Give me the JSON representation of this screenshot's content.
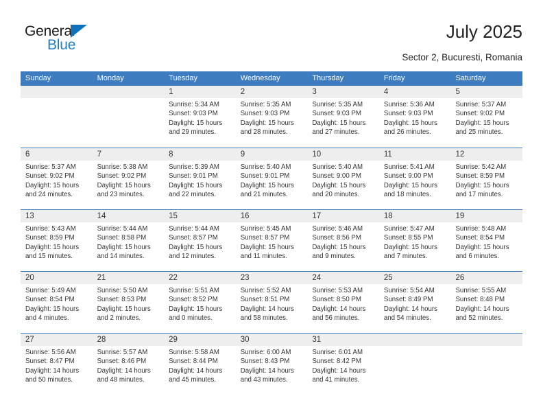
{
  "logo": {
    "word1": "General",
    "word2": "Blue",
    "triangle_color": "#1172ba",
    "word2_color": "#1f7ec4"
  },
  "header": {
    "title": "July 2025",
    "subtitle": "Sector 2, Bucuresti, Romania"
  },
  "theme": {
    "header_bg": "#3d7dbf",
    "header_text": "#ffffff",
    "daynum_band_bg": "#eeeeee",
    "row_divider": "#3d7dbf",
    "body_text": "#333333"
  },
  "weekdays": [
    "Sunday",
    "Monday",
    "Tuesday",
    "Wednesday",
    "Thursday",
    "Friday",
    "Saturday"
  ],
  "labels": {
    "sunrise": "Sunrise:",
    "sunset": "Sunset:",
    "daylight": "Daylight:"
  },
  "weeks": [
    [
      {
        "day": "",
        "blank": true
      },
      {
        "day": "",
        "blank": true
      },
      {
        "day": "1",
        "sunrise": "Sunrise: 5:34 AM",
        "sunset": "Sunset: 9:03 PM",
        "daylight1": "Daylight: 15 hours",
        "daylight2": "and 29 minutes."
      },
      {
        "day": "2",
        "sunrise": "Sunrise: 5:35 AM",
        "sunset": "Sunset: 9:03 PM",
        "daylight1": "Daylight: 15 hours",
        "daylight2": "and 28 minutes."
      },
      {
        "day": "3",
        "sunrise": "Sunrise: 5:35 AM",
        "sunset": "Sunset: 9:03 PM",
        "daylight1": "Daylight: 15 hours",
        "daylight2": "and 27 minutes."
      },
      {
        "day": "4",
        "sunrise": "Sunrise: 5:36 AM",
        "sunset": "Sunset: 9:03 PM",
        "daylight1": "Daylight: 15 hours",
        "daylight2": "and 26 minutes."
      },
      {
        "day": "5",
        "sunrise": "Sunrise: 5:37 AM",
        "sunset": "Sunset: 9:02 PM",
        "daylight1": "Daylight: 15 hours",
        "daylight2": "and 25 minutes."
      }
    ],
    [
      {
        "day": "6",
        "sunrise": "Sunrise: 5:37 AM",
        "sunset": "Sunset: 9:02 PM",
        "daylight1": "Daylight: 15 hours",
        "daylight2": "and 24 minutes."
      },
      {
        "day": "7",
        "sunrise": "Sunrise: 5:38 AM",
        "sunset": "Sunset: 9:02 PM",
        "daylight1": "Daylight: 15 hours",
        "daylight2": "and 23 minutes."
      },
      {
        "day": "8",
        "sunrise": "Sunrise: 5:39 AM",
        "sunset": "Sunset: 9:01 PM",
        "daylight1": "Daylight: 15 hours",
        "daylight2": "and 22 minutes."
      },
      {
        "day": "9",
        "sunrise": "Sunrise: 5:40 AM",
        "sunset": "Sunset: 9:01 PM",
        "daylight1": "Daylight: 15 hours",
        "daylight2": "and 21 minutes."
      },
      {
        "day": "10",
        "sunrise": "Sunrise: 5:40 AM",
        "sunset": "Sunset: 9:00 PM",
        "daylight1": "Daylight: 15 hours",
        "daylight2": "and 20 minutes."
      },
      {
        "day": "11",
        "sunrise": "Sunrise: 5:41 AM",
        "sunset": "Sunset: 9:00 PM",
        "daylight1": "Daylight: 15 hours",
        "daylight2": "and 18 minutes."
      },
      {
        "day": "12",
        "sunrise": "Sunrise: 5:42 AM",
        "sunset": "Sunset: 8:59 PM",
        "daylight1": "Daylight: 15 hours",
        "daylight2": "and 17 minutes."
      }
    ],
    [
      {
        "day": "13",
        "sunrise": "Sunrise: 5:43 AM",
        "sunset": "Sunset: 8:59 PM",
        "daylight1": "Daylight: 15 hours",
        "daylight2": "and 15 minutes."
      },
      {
        "day": "14",
        "sunrise": "Sunrise: 5:44 AM",
        "sunset": "Sunset: 8:58 PM",
        "daylight1": "Daylight: 15 hours",
        "daylight2": "and 14 minutes."
      },
      {
        "day": "15",
        "sunrise": "Sunrise: 5:44 AM",
        "sunset": "Sunset: 8:57 PM",
        "daylight1": "Daylight: 15 hours",
        "daylight2": "and 12 minutes."
      },
      {
        "day": "16",
        "sunrise": "Sunrise: 5:45 AM",
        "sunset": "Sunset: 8:57 PM",
        "daylight1": "Daylight: 15 hours",
        "daylight2": "and 11 minutes."
      },
      {
        "day": "17",
        "sunrise": "Sunrise: 5:46 AM",
        "sunset": "Sunset: 8:56 PM",
        "daylight1": "Daylight: 15 hours",
        "daylight2": "and 9 minutes."
      },
      {
        "day": "18",
        "sunrise": "Sunrise: 5:47 AM",
        "sunset": "Sunset: 8:55 PM",
        "daylight1": "Daylight: 15 hours",
        "daylight2": "and 7 minutes."
      },
      {
        "day": "19",
        "sunrise": "Sunrise: 5:48 AM",
        "sunset": "Sunset: 8:54 PM",
        "daylight1": "Daylight: 15 hours",
        "daylight2": "and 6 minutes."
      }
    ],
    [
      {
        "day": "20",
        "sunrise": "Sunrise: 5:49 AM",
        "sunset": "Sunset: 8:54 PM",
        "daylight1": "Daylight: 15 hours",
        "daylight2": "and 4 minutes."
      },
      {
        "day": "21",
        "sunrise": "Sunrise: 5:50 AM",
        "sunset": "Sunset: 8:53 PM",
        "daylight1": "Daylight: 15 hours",
        "daylight2": "and 2 minutes."
      },
      {
        "day": "22",
        "sunrise": "Sunrise: 5:51 AM",
        "sunset": "Sunset: 8:52 PM",
        "daylight1": "Daylight: 15 hours",
        "daylight2": "and 0 minutes."
      },
      {
        "day": "23",
        "sunrise": "Sunrise: 5:52 AM",
        "sunset": "Sunset: 8:51 PM",
        "daylight1": "Daylight: 14 hours",
        "daylight2": "and 58 minutes."
      },
      {
        "day": "24",
        "sunrise": "Sunrise: 5:53 AM",
        "sunset": "Sunset: 8:50 PM",
        "daylight1": "Daylight: 14 hours",
        "daylight2": "and 56 minutes."
      },
      {
        "day": "25",
        "sunrise": "Sunrise: 5:54 AM",
        "sunset": "Sunset: 8:49 PM",
        "daylight1": "Daylight: 14 hours",
        "daylight2": "and 54 minutes."
      },
      {
        "day": "26",
        "sunrise": "Sunrise: 5:55 AM",
        "sunset": "Sunset: 8:48 PM",
        "daylight1": "Daylight: 14 hours",
        "daylight2": "and 52 minutes."
      }
    ],
    [
      {
        "day": "27",
        "sunrise": "Sunrise: 5:56 AM",
        "sunset": "Sunset: 8:47 PM",
        "daylight1": "Daylight: 14 hours",
        "daylight2": "and 50 minutes."
      },
      {
        "day": "28",
        "sunrise": "Sunrise: 5:57 AM",
        "sunset": "Sunset: 8:46 PM",
        "daylight1": "Daylight: 14 hours",
        "daylight2": "and 48 minutes."
      },
      {
        "day": "29",
        "sunrise": "Sunrise: 5:58 AM",
        "sunset": "Sunset: 8:44 PM",
        "daylight1": "Daylight: 14 hours",
        "daylight2": "and 45 minutes."
      },
      {
        "day": "30",
        "sunrise": "Sunrise: 6:00 AM",
        "sunset": "Sunset: 8:43 PM",
        "daylight1": "Daylight: 14 hours",
        "daylight2": "and 43 minutes."
      },
      {
        "day": "31",
        "sunrise": "Sunrise: 6:01 AM",
        "sunset": "Sunset: 8:42 PM",
        "daylight1": "Daylight: 14 hours",
        "daylight2": "and 41 minutes."
      },
      {
        "day": "",
        "blank": true
      },
      {
        "day": "",
        "blank": true
      }
    ]
  ]
}
